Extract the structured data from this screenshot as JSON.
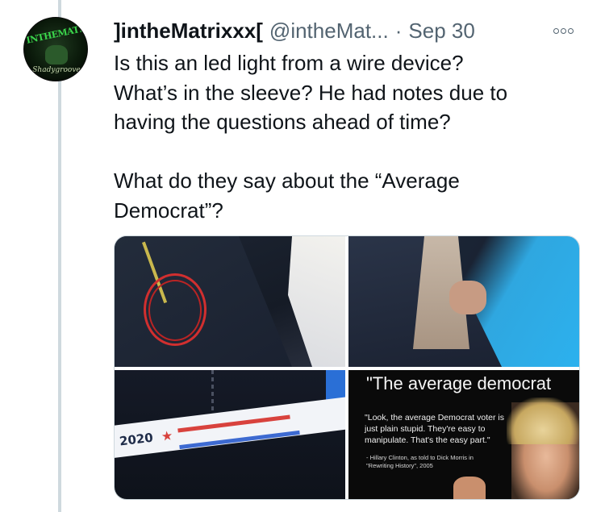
{
  "tweet": {
    "display_name": "]intheMatrixxx[",
    "handle": "@intheMat...",
    "separator": "·",
    "date": "Sep 30",
    "text_paragraph_1": "Is this an led light from a wire device?\nWhat’s in the sleeve? He had notes due to\nhaving the questions ahead of time?",
    "text_paragraph_2": "What do they say about the “Average\nDemocrat”?"
  },
  "avatar": {
    "text_top": "INTHEMATRIXXX",
    "text_bottom": "Shadygroove"
  },
  "icons": {
    "more": "more-options-icon"
  },
  "media": {
    "tile_3": {
      "year_text": "2020",
      "star": "★"
    },
    "tile_4": {
      "headline": "\"The average democrat",
      "quote": "\"Look, the average Democrat voter is just plain stupid. They're easy to manipulate. That's the easy part.\"",
      "credit": "- Hillary Clinton, as told to Dick Morris in \"Rewriting History\", 2005"
    }
  },
  "colors": {
    "text_primary": "#0f1419",
    "text_secondary": "#536471",
    "thread_line": "#cfd9de",
    "annotation_red": "#d12f2f"
  }
}
